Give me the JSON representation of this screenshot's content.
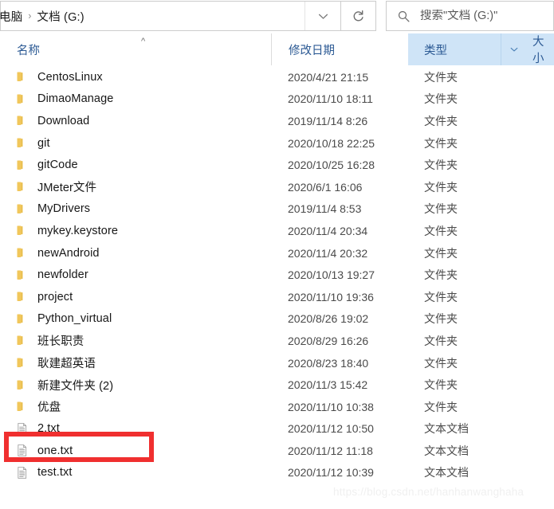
{
  "window": {
    "title": "文档 (G:)"
  },
  "address_bar": {
    "breadcrumbs": [
      "电脑",
      "文档 (G:)"
    ],
    "separator": "›",
    "dropdown_icon": "chevron-down-icon",
    "refresh_icon": "refresh-icon",
    "refresh_tooltip": "刷新"
  },
  "search": {
    "icon": "search-icon",
    "placeholder": "搜索\"文档 (G:)\"",
    "value": ""
  },
  "columns": {
    "name": "名称",
    "date_modified": "修改日期",
    "type": "类型",
    "size": "大小",
    "sort_indicator": "^",
    "sorted_by": "名称",
    "sort_direction": "ascending",
    "hovered_column": "类型",
    "filter_icon": "chevron-down-icon"
  },
  "colors": {
    "header_text": "#2c5a94",
    "header_hover_bg": "#cfe4f7",
    "folder_icon": "#f5c451",
    "annotation_red": "#f02f2f",
    "watermark": "#f0f0f0"
  },
  "annotation": {
    "type": "rectangle",
    "color": "#f02f2f",
    "targets": "one.txt"
  },
  "watermark": {
    "text": "https://blog.csdn.net/hanhanwanghaha"
  },
  "files": [
    {
      "name": "CentosLinux",
      "date": "2020/4/21 21:15",
      "type": "文件夹",
      "icon": "folder-icon",
      "size": ""
    },
    {
      "name": "DimaoManage",
      "date": "2020/11/10 18:11",
      "type": "文件夹",
      "icon": "folder-icon",
      "size": ""
    },
    {
      "name": "Download",
      "date": "2019/11/14 8:26",
      "type": "文件夹",
      "icon": "folder-icon",
      "size": ""
    },
    {
      "name": "git",
      "date": "2020/10/18 22:25",
      "type": "文件夹",
      "icon": "folder-icon",
      "size": ""
    },
    {
      "name": "gitCode",
      "date": "2020/10/25 16:28",
      "type": "文件夹",
      "icon": "folder-icon",
      "size": ""
    },
    {
      "name": "JMeter文件",
      "date": "2020/6/1 16:06",
      "type": "文件夹",
      "icon": "folder-icon",
      "size": ""
    },
    {
      "name": "MyDrivers",
      "date": "2019/11/4 8:53",
      "type": "文件夹",
      "icon": "folder-icon",
      "size": ""
    },
    {
      "name": "mykey.keystore",
      "date": "2020/11/4 20:34",
      "type": "文件夹",
      "icon": "folder-icon",
      "size": ""
    },
    {
      "name": "newAndroid",
      "date": "2020/11/4 20:32",
      "type": "文件夹",
      "icon": "folder-icon",
      "size": ""
    },
    {
      "name": "newfolder",
      "date": "2020/10/13 19:27",
      "type": "文件夹",
      "icon": "folder-icon",
      "size": ""
    },
    {
      "name": "project",
      "date": "2020/11/10 19:36",
      "type": "文件夹",
      "icon": "folder-icon",
      "size": ""
    },
    {
      "name": "Python_virtual",
      "date": "2020/8/26 19:02",
      "type": "文件夹",
      "icon": "folder-icon",
      "size": ""
    },
    {
      "name": "班长职责",
      "date": "2020/8/29 16:26",
      "type": "文件夹",
      "icon": "folder-icon",
      "size": ""
    },
    {
      "name": "耿建超英语",
      "date": "2020/8/23 18:40",
      "type": "文件夹",
      "icon": "folder-icon",
      "size": ""
    },
    {
      "name": "新建文件夹 (2)",
      "date": "2020/11/3 15:42",
      "type": "文件夹",
      "icon": "folder-icon",
      "size": ""
    },
    {
      "name": "优盘",
      "date": "2020/11/10 10:38",
      "type": "文件夹",
      "icon": "folder-icon",
      "size": ""
    },
    {
      "name": "2.txt",
      "date": "2020/11/12 10:50",
      "type": "文本文档",
      "icon": "text-document-icon",
      "size": ""
    },
    {
      "name": "one.txt",
      "date": "2020/11/12 11:18",
      "type": "文本文档",
      "icon": "text-document-icon",
      "size": ""
    },
    {
      "name": "test.txt",
      "date": "2020/11/12 10:39",
      "type": "文本文档",
      "icon": "text-document-icon",
      "size": ""
    }
  ]
}
